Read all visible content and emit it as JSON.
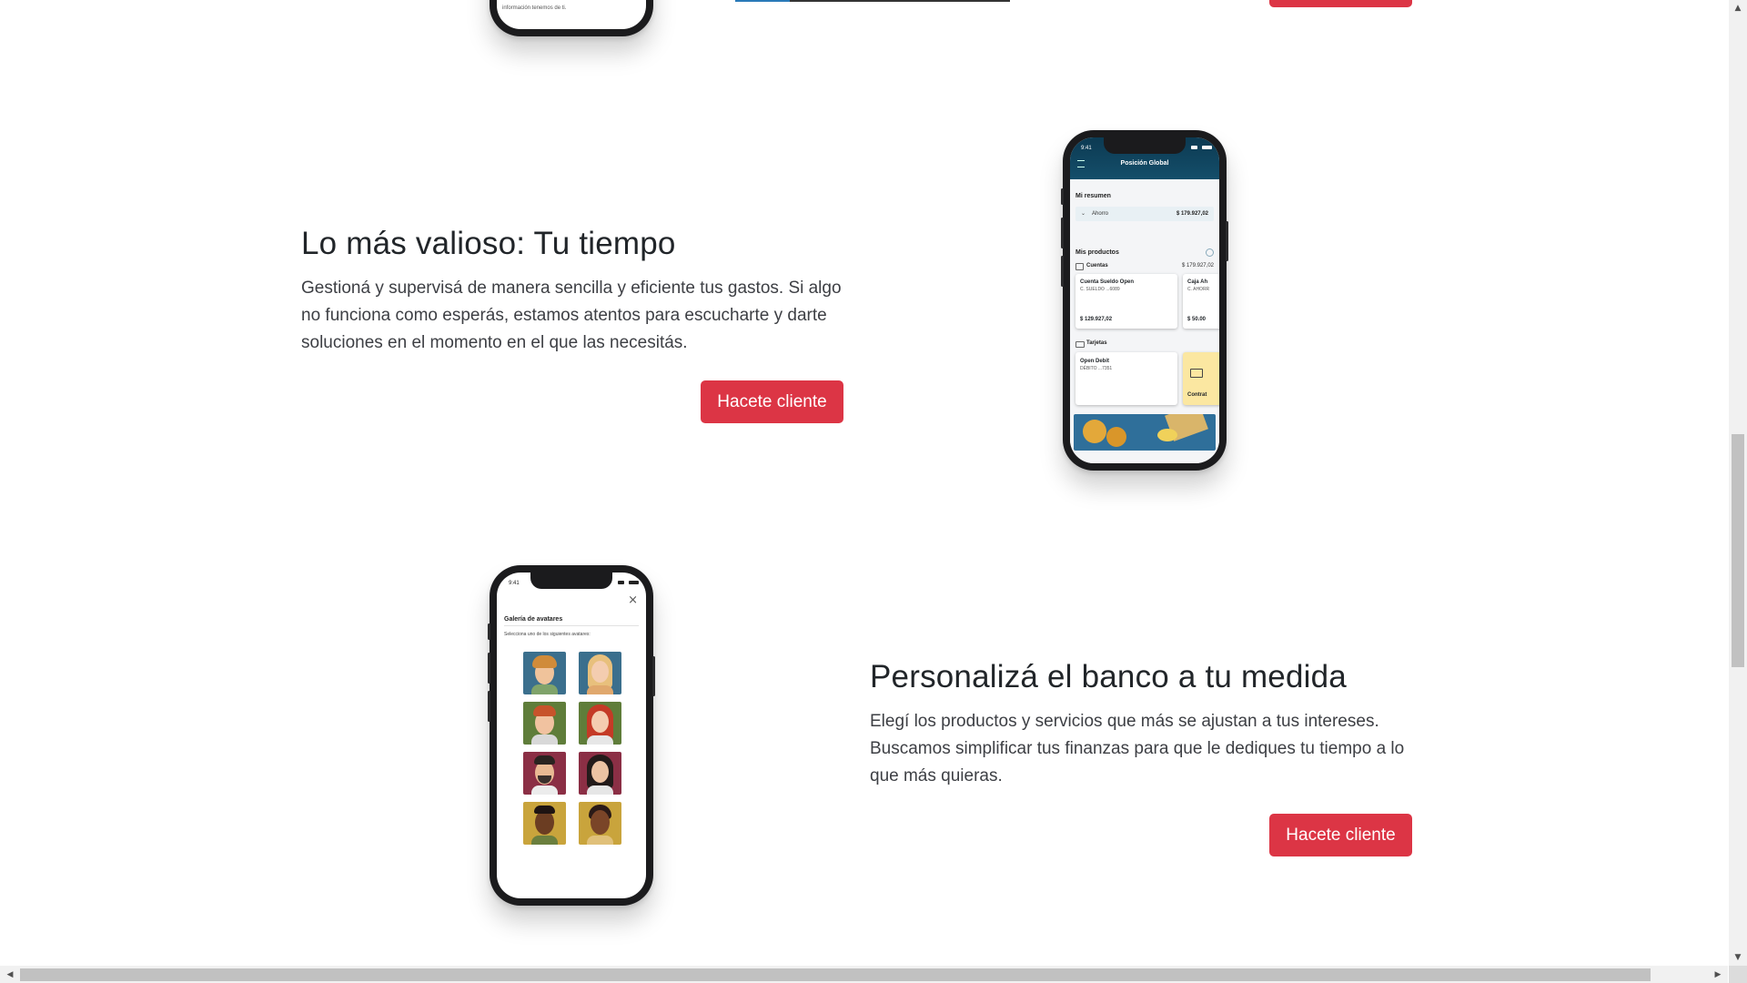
{
  "sections": [
    {
      "title": "Lo más valioso: Tu tiempo",
      "description": "Gestioná y supervisá de manera sencilla y eficiente tus gastos. Si algo no funciona como esperás, estamos atentos para escucharte y darte soluciones en el momento en el que las necesitás.",
      "cta_label": "Hacete cliente"
    },
    {
      "title": "Personalizá el banco a tu medida",
      "description": "Elegí los productos y servicios que más se ajustan a tus intereses. Buscamos simplificar tus finanzas para que le dediques tu tiempo a lo que más quieras.",
      "cta_label": "Hacete cliente"
    }
  ],
  "top_phone": {
    "text": "información tenemos de ti."
  },
  "phone_position_global": {
    "time": "9:41",
    "header": "Posición Global",
    "summary_title": "Mi resumen",
    "summary_item": "Ahorro",
    "summary_amount": "$ 179.927,02",
    "products_title": "Mis productos",
    "accounts_label": "Cuentas",
    "accounts_amount": "$ 179.927,02",
    "account1_name": "Cuenta Sueldo Open",
    "account1_sub": "C. SUELDO ...6089",
    "account1_amount": "$ 129.927,02",
    "account2_name": "Caja Ah",
    "account2_sub": "C. AHORR",
    "account2_amount": "$ 50.00",
    "cards_label": "Tarjetas",
    "card1_name": "Open Debit",
    "card1_sub": "DÉBITO ...7351",
    "card2_label": "Contrat"
  },
  "phone_avatars": {
    "time": "9:41",
    "title": "Galería de avatares",
    "subtitle": "Selecciona uno de los siguientes avatares:"
  },
  "colors": {
    "cta": "#dc3545",
    "app_header": "#0c3a52"
  }
}
